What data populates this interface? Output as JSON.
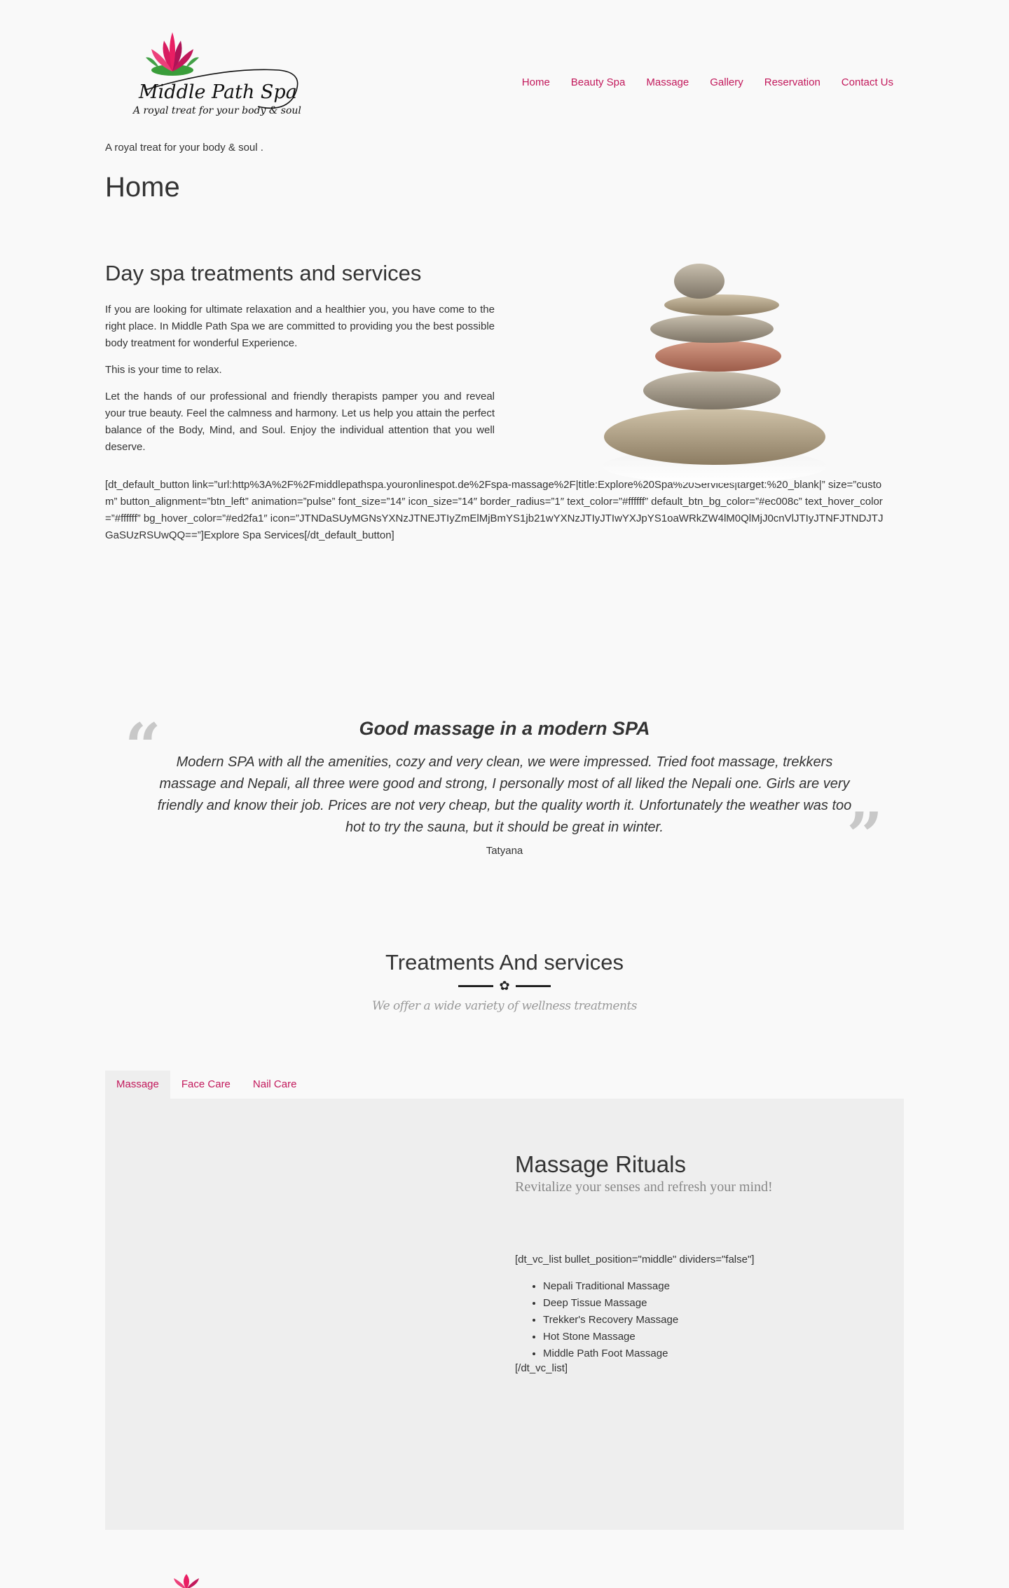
{
  "brand": {
    "name": "Middle Path Spa",
    "slogan": "A royal treat for your body & soul",
    "accent": "#c2185b"
  },
  "nav": {
    "items": [
      "Home",
      "Beauty Spa",
      "Massage",
      "Gallery",
      "Reservation",
      "Contact Us"
    ]
  },
  "tagline": "A royal treat for your body & soul .",
  "page_title": "Home",
  "intro": {
    "heading": "Day spa treatments and services",
    "p1": "If you are looking for ultimate relaxation and a healthier you, you have come to the right place. In Middle Path Spa we are committed to providing you the best possible body treatment for wonderful Experience.",
    "p2": "This is your time to relax.",
    "p3": "Let the hands of our professional and friendly therapists pamper you and reveal your true beauty. Feel the calmness and harmony. Let us help you attain the perfect balance of the Body, Mind, and Soul. Enjoy the individual attention that you well deserve.",
    "shortcode": "[dt_default_button link=”url:http%3A%2F%2Fmiddlepathspa.youronlinespot.de%2Fspa-massage%2F|title:Explore%20Spa%20Services|target:%20_blank|” size=”custom” button_alignment=”btn_left” animation=”pulse” font_size=”14″ icon_size=”14″ border_radius=”1″ text_color=”#ffffff” default_btn_bg_color=”#ec008c” text_hover_color=”#ffffff” bg_hover_color=”#ed2fa1″ icon=”JTNDaSUyMGNsYXNzJTNEJTIyZmElMjBmYS1jb21wYXNzJTIyJTIwYXJpYS1oaWRkZW4lM0QlMjJ0cnVlJTIyJTNFJTNDJTJGaSUzRSUwQQ==”]Explore Spa Services[/dt_default_button]"
  },
  "testimonial": {
    "title": "Good massage in a modern SPA",
    "body": "Modern SPA with all the amenities, cozy and very clean, we were impressed. Tried foot massage, trekkers massage and Nepali, all three were good and strong, I personally most of all liked the Nepali one. Girls are very friendly and know their job. Prices are not very cheap, but the quality worth it. Unfortunately the weather was too hot to try the sauna, but it should be great in winter.",
    "author": "Tatyana"
  },
  "treatments": {
    "heading": "Treatments And services",
    "subheading": "We offer a wide variety of wellness treatments"
  },
  "tabs": {
    "items": [
      "Massage",
      "Face Care",
      "Nail Care"
    ],
    "active": "Massage"
  },
  "panel": {
    "heading": "Massage Rituals",
    "subheading": "Revitalize your senses and refresh your mind!",
    "code_open": "[dt_vc_list bullet_position=\"middle\" dividers=\"false\"]",
    "list": [
      "Nepali Traditional Massage",
      "Deep Tissue Massage",
      "Trekker's Recovery Massage",
      "Hot Stone Massage",
      "Middle Path Foot Massage"
    ],
    "code_close": "[/dt_vc_list]"
  }
}
